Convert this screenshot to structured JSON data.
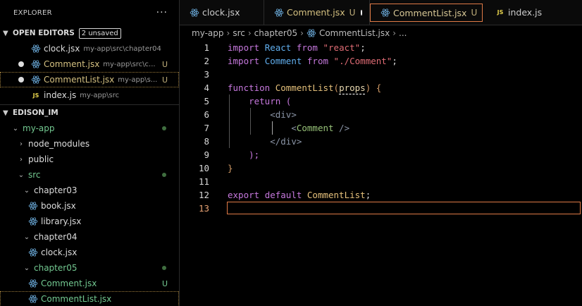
{
  "explorer": {
    "title": "EXPLORER",
    "more": "···"
  },
  "open_editors": {
    "title": "OPEN EDITORS",
    "badge": "2 unsaved",
    "items": [
      {
        "name": "clock.jsx",
        "path": "my-app\\src\\chapter04",
        "status": ""
      },
      {
        "name": "Comment.jsx",
        "path": "my-app\\src\\c...",
        "status": "U"
      },
      {
        "name": "CommentList.jsx",
        "path": "my-app\\s...",
        "status": "U"
      },
      {
        "name": "index.js",
        "path": "my-app\\src",
        "status": ""
      }
    ],
    "js_label": "JS"
  },
  "workspace": {
    "title": "EDISON_IM",
    "tree": [
      {
        "label": "my-app"
      },
      {
        "label": "node_modules"
      },
      {
        "label": "public"
      },
      {
        "label": "src"
      },
      {
        "label": "chapter03"
      },
      {
        "label": "book.jsx"
      },
      {
        "label": "library.jsx"
      },
      {
        "label": "chapter04"
      },
      {
        "label": "clock.jsx"
      },
      {
        "label": "chapter05"
      },
      {
        "label": "Comment.jsx",
        "status": "U"
      },
      {
        "label": "CommentList.jsx"
      }
    ]
  },
  "tabs": [
    {
      "label": "clock.jsx"
    },
    {
      "label": "Comment.jsx",
      "status": "U"
    },
    {
      "label": "CommentList.jsx",
      "status": "U"
    },
    {
      "label": "index.js"
    }
  ],
  "breadcrumb": [
    "my-app",
    "src",
    "chapter05",
    "CommentList.jsx",
    "..."
  ],
  "code": {
    "line_numbers": [
      "1",
      "2",
      "3",
      "4",
      "5",
      "6",
      "7",
      "8",
      "9",
      "10",
      "11",
      "12",
      "13"
    ],
    "l1": {
      "kw": "import",
      "id": "React",
      "from": "from",
      "str": "\"react\"",
      "end": ";"
    },
    "l2": {
      "kw": "import",
      "id": "Comment",
      "from": "from",
      "str": "\"./Comment\"",
      "end": ";"
    },
    "l4": {
      "kw": "function",
      "fn": "CommentList",
      "open": "(",
      "param": "props",
      "close": ")",
      "brace": "{"
    },
    "l5": {
      "kw": "return",
      "paren": "("
    },
    "l6": {
      "tag": "<div>"
    },
    "l7": {
      "open": "<",
      "comp": "Comment",
      "close": " />"
    },
    "l8": {
      "tag": "</div>"
    },
    "l9": {
      "text": ");"
    },
    "l10": {
      "brace": "}"
    },
    "l12": {
      "kw": "export",
      "kw2": "default",
      "id": "CommentList",
      "end": ";"
    }
  },
  "colors": {
    "accent": "#e07a46",
    "untracked": "#73c991"
  }
}
